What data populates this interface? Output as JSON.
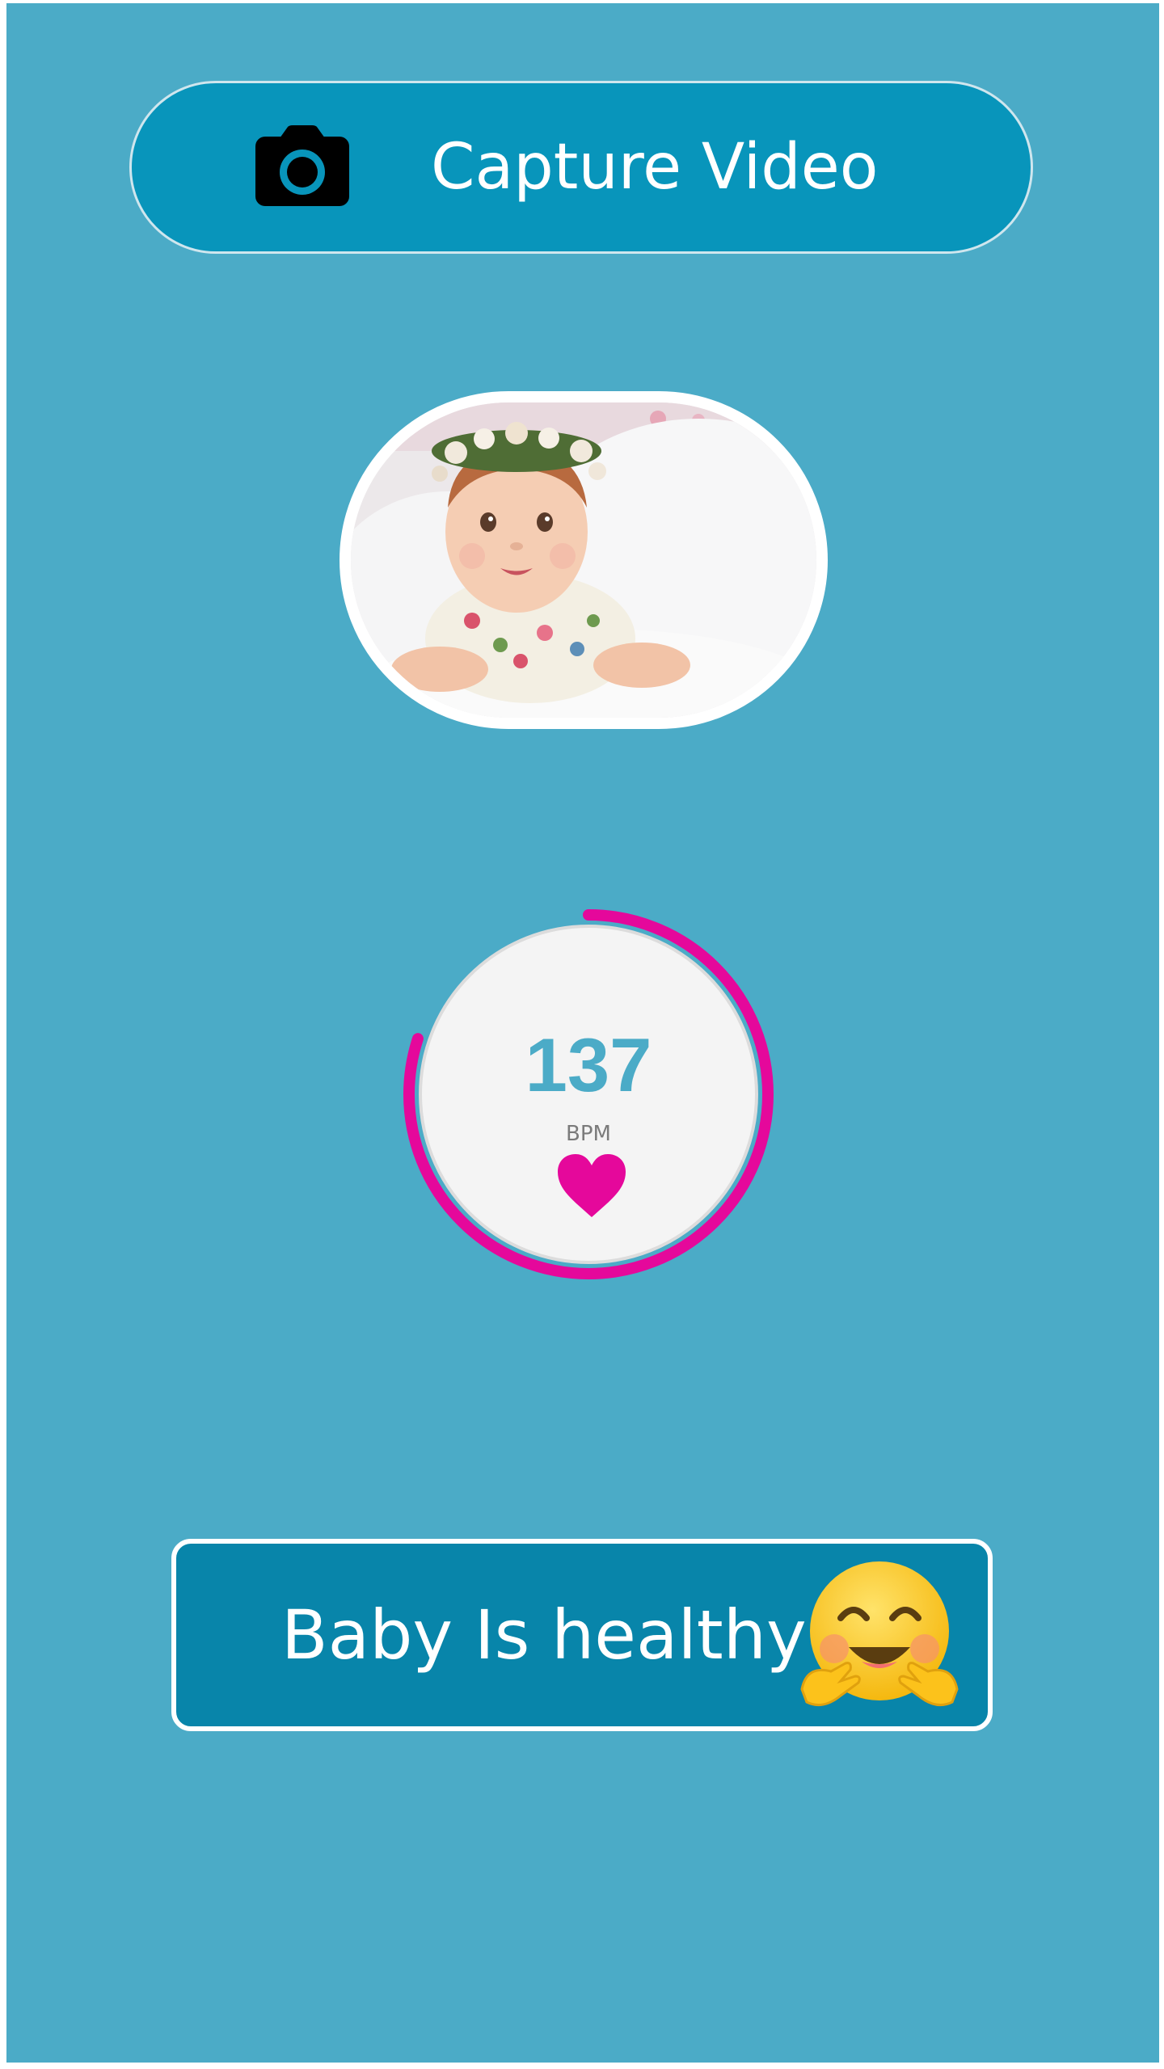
{
  "capture_button": {
    "label": "Capture Video",
    "icon": "camera-icon"
  },
  "photo": {
    "subject": "baby-photo"
  },
  "heart_rate": {
    "value": "137",
    "unit": "BPM",
    "progress_fraction": 0.8,
    "ring_color": "#e5089b",
    "icon": "heart-icon"
  },
  "status": {
    "text": "Baby Is healthy",
    "emoji": "hugging-face-emoji"
  },
  "colors": {
    "background": "#4babc7",
    "button": "#0895bb",
    "status_box": "#0885aa",
    "accent": "#e5089b"
  }
}
